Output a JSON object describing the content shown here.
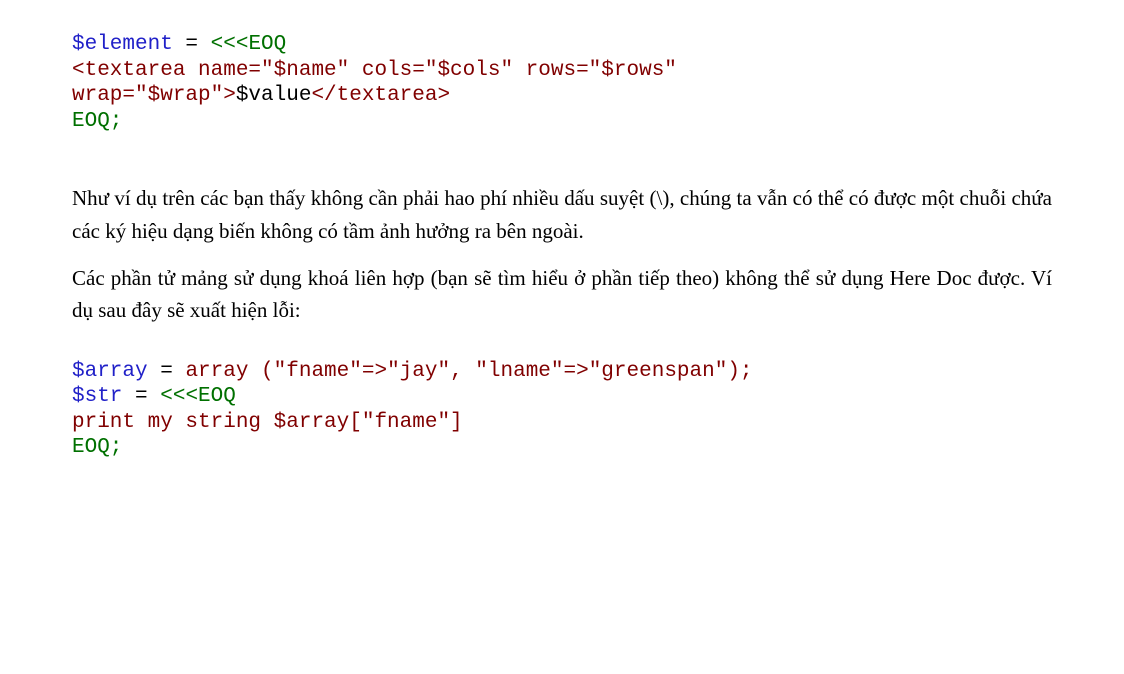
{
  "code1": {
    "var": "$element",
    "eq": " = ",
    "eoq_open": "<<<EOQ",
    "html_line1": "<textarea name=\"$name\" cols=\"$cols\" rows=\"$rows\" ",
    "html_line2_a": "wrap=\"$wrap\">",
    "html_line2_b": "$value",
    "html_line2_c": "</textarea>",
    "eoq_close": "EOQ;"
  },
  "paragraph1": "Như ví dụ trên các bạn thấy không cần phải hao phí nhiều dấu suyệt (\\), chúng ta vẫn có thể có được một chuỗi chứa các ký hiệu dạng biến không có tầm ảnh hưởng ra bên ngoài.",
  "paragraph2": "Các phần tử mảng sử dụng khoá liên hợp (bạn sẽ tìm hiểu ở phần tiếp theo) không thể sử dụng Here Doc được. Ví dụ sau đây sẽ xuất hiện lỗi:",
  "code2": {
    "l1_a": "$array",
    "l1_b": " = ",
    "l1_c": "array (\"fname\"=>\"jay\", \"lname\"=>\"greenspan\");",
    "l2_a": "$str",
    "l2_b": " = ",
    "l2_c": "<<<EOQ",
    "l3": "print my string $array[\"fname\"]",
    "l4": "EOQ;"
  }
}
